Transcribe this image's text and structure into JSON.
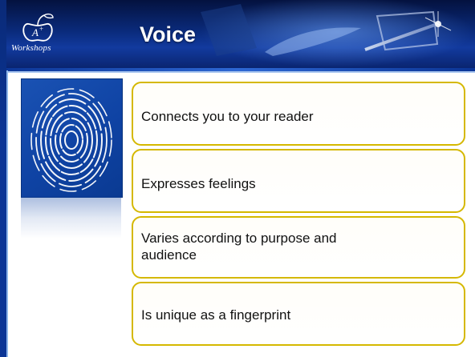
{
  "slide": {
    "title": "Voice",
    "logo": {
      "name": "Workshops"
    },
    "bullets": [
      {
        "text": "Connects you to your reader"
      },
      {
        "text": "Expresses feelings"
      },
      {
        "text": "Varies according to purpose and audience"
      },
      {
        "text": "Is unique as a fingerprint"
      }
    ]
  },
  "colors": {
    "header_blue": "#0a2a7a",
    "accent_gold": "#d5b800",
    "fingerprint_box": "#0f43a4"
  }
}
